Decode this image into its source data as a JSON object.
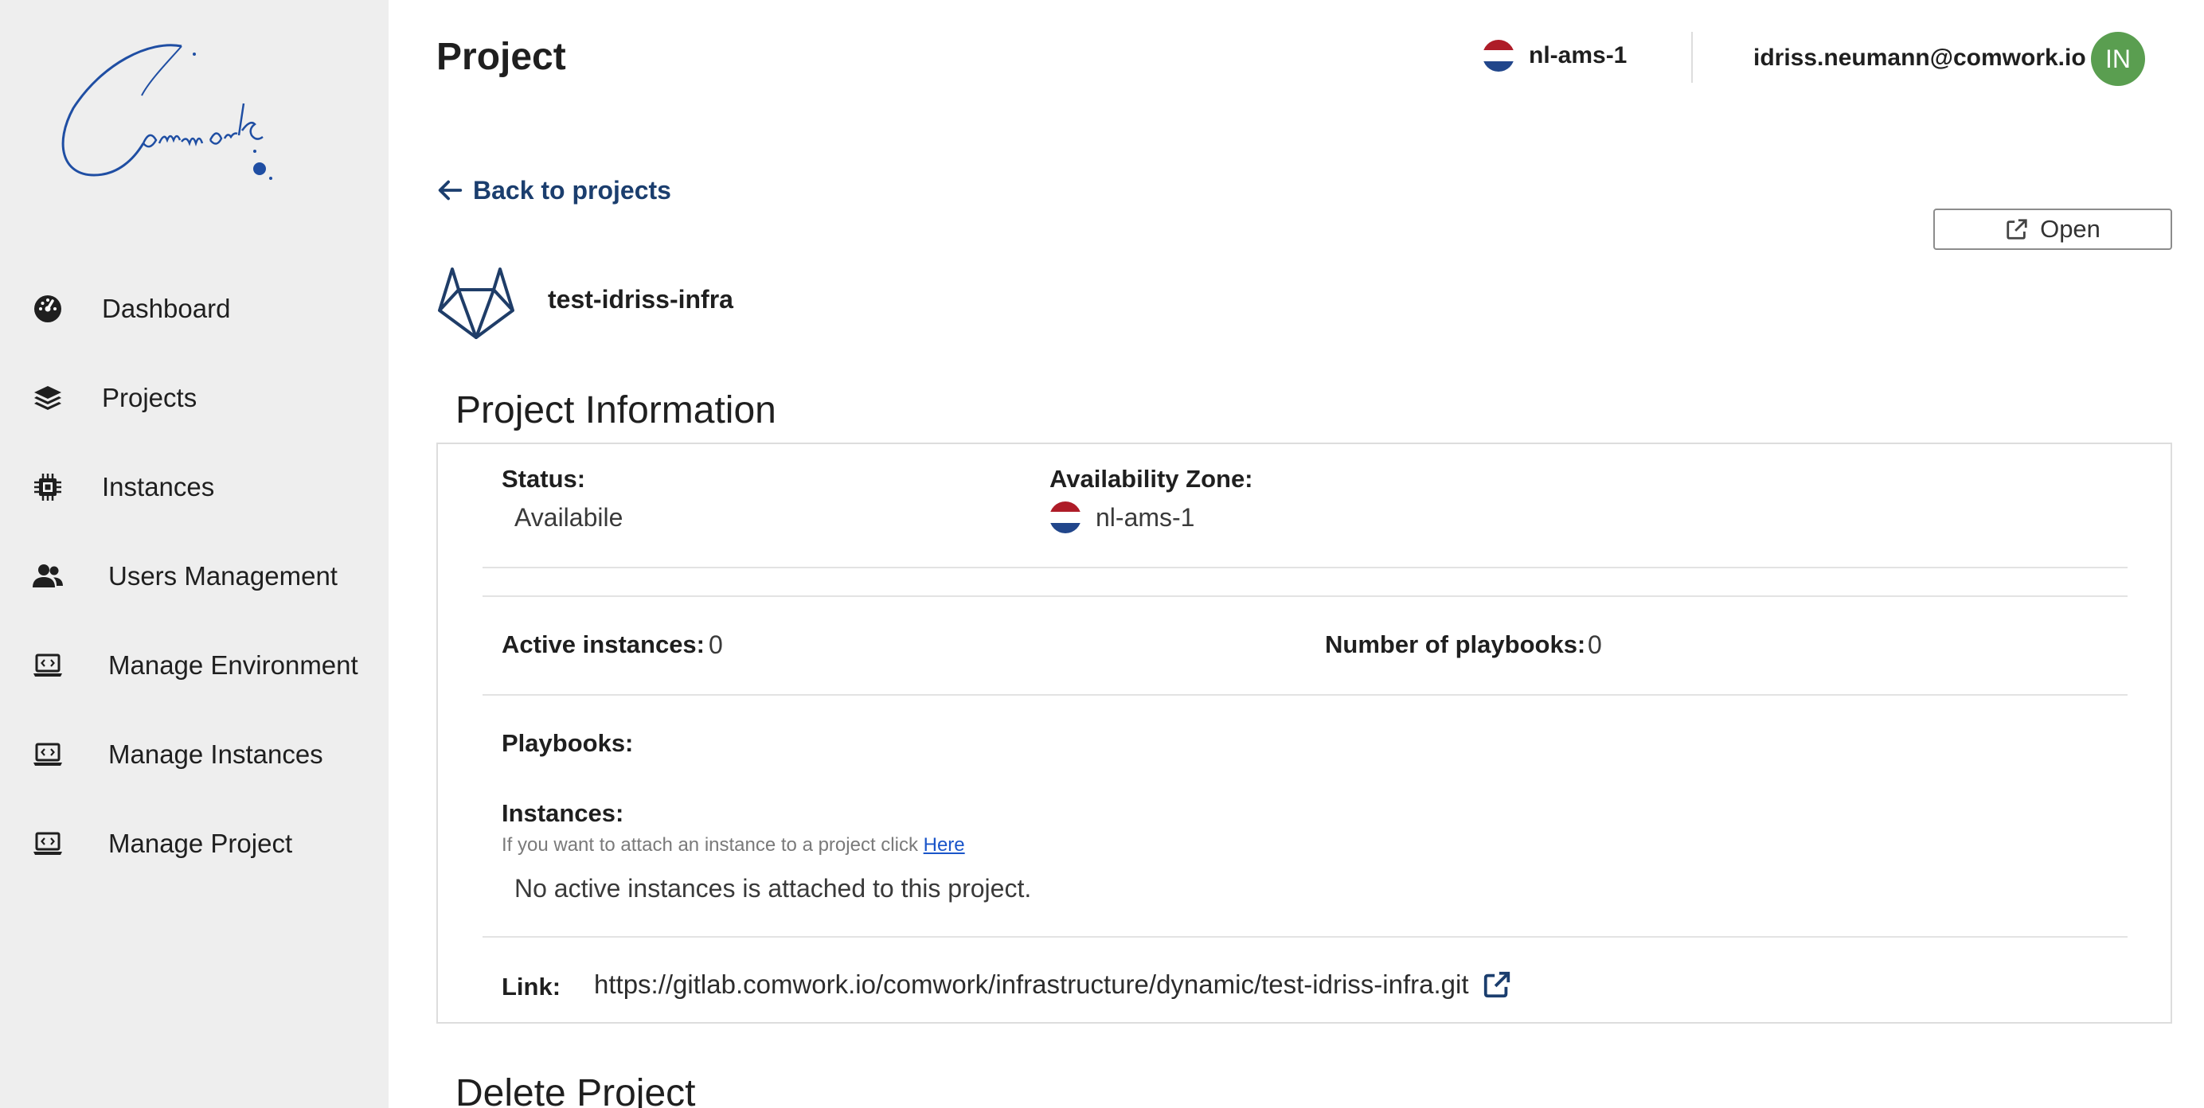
{
  "sidebar": {
    "items": [
      {
        "label": "Dashboard",
        "icon": "dashboard-icon"
      },
      {
        "label": "Projects",
        "icon": "layers-icon"
      },
      {
        "label": "Instances",
        "icon": "chip-icon"
      },
      {
        "label": "Users Management",
        "icon": "users-icon"
      },
      {
        "label": "Manage Environment",
        "icon": "laptop-code-icon"
      },
      {
        "label": "Manage Instances",
        "icon": "laptop-code-icon"
      },
      {
        "label": "Manage Project",
        "icon": "laptop-code-icon"
      }
    ]
  },
  "header": {
    "title": "Project",
    "region": "nl-ams-1",
    "user_email": "idriss.neumann@comwork.io",
    "avatar_initials": "IN"
  },
  "back_link": "Back to projects",
  "open_button": "Open",
  "project": {
    "name": "test-idriss-infra",
    "icon": "gitlab-icon"
  },
  "info": {
    "section_title": "Project Information",
    "status_label": "Status:",
    "status_value": "Availabile",
    "zone_label": "Availability Zone:",
    "zone_value": "nl-ams-1",
    "active_instances_label": "Active instances:",
    "active_instances_value": "0",
    "playbooks_count_label": "Number of playbooks:",
    "playbooks_count_value": "0",
    "playbooks_label": "Playbooks:",
    "instances_label": "Instances:",
    "instances_hint": "If you want to attach an instance to a project click",
    "instances_hint_link": "Here",
    "instances_empty": "No active instances is attached to this project.",
    "link_label": "Link:",
    "link_url": "https://gitlab.comwork.io/comwork/infrastructure/dynamic/test-idriss-infra.git"
  },
  "delete_section_title": "Delete Project",
  "colors": {
    "accent": "#1b3e6e",
    "avatar": "#5a9e50",
    "sidebar_bg": "#eeeeee"
  }
}
